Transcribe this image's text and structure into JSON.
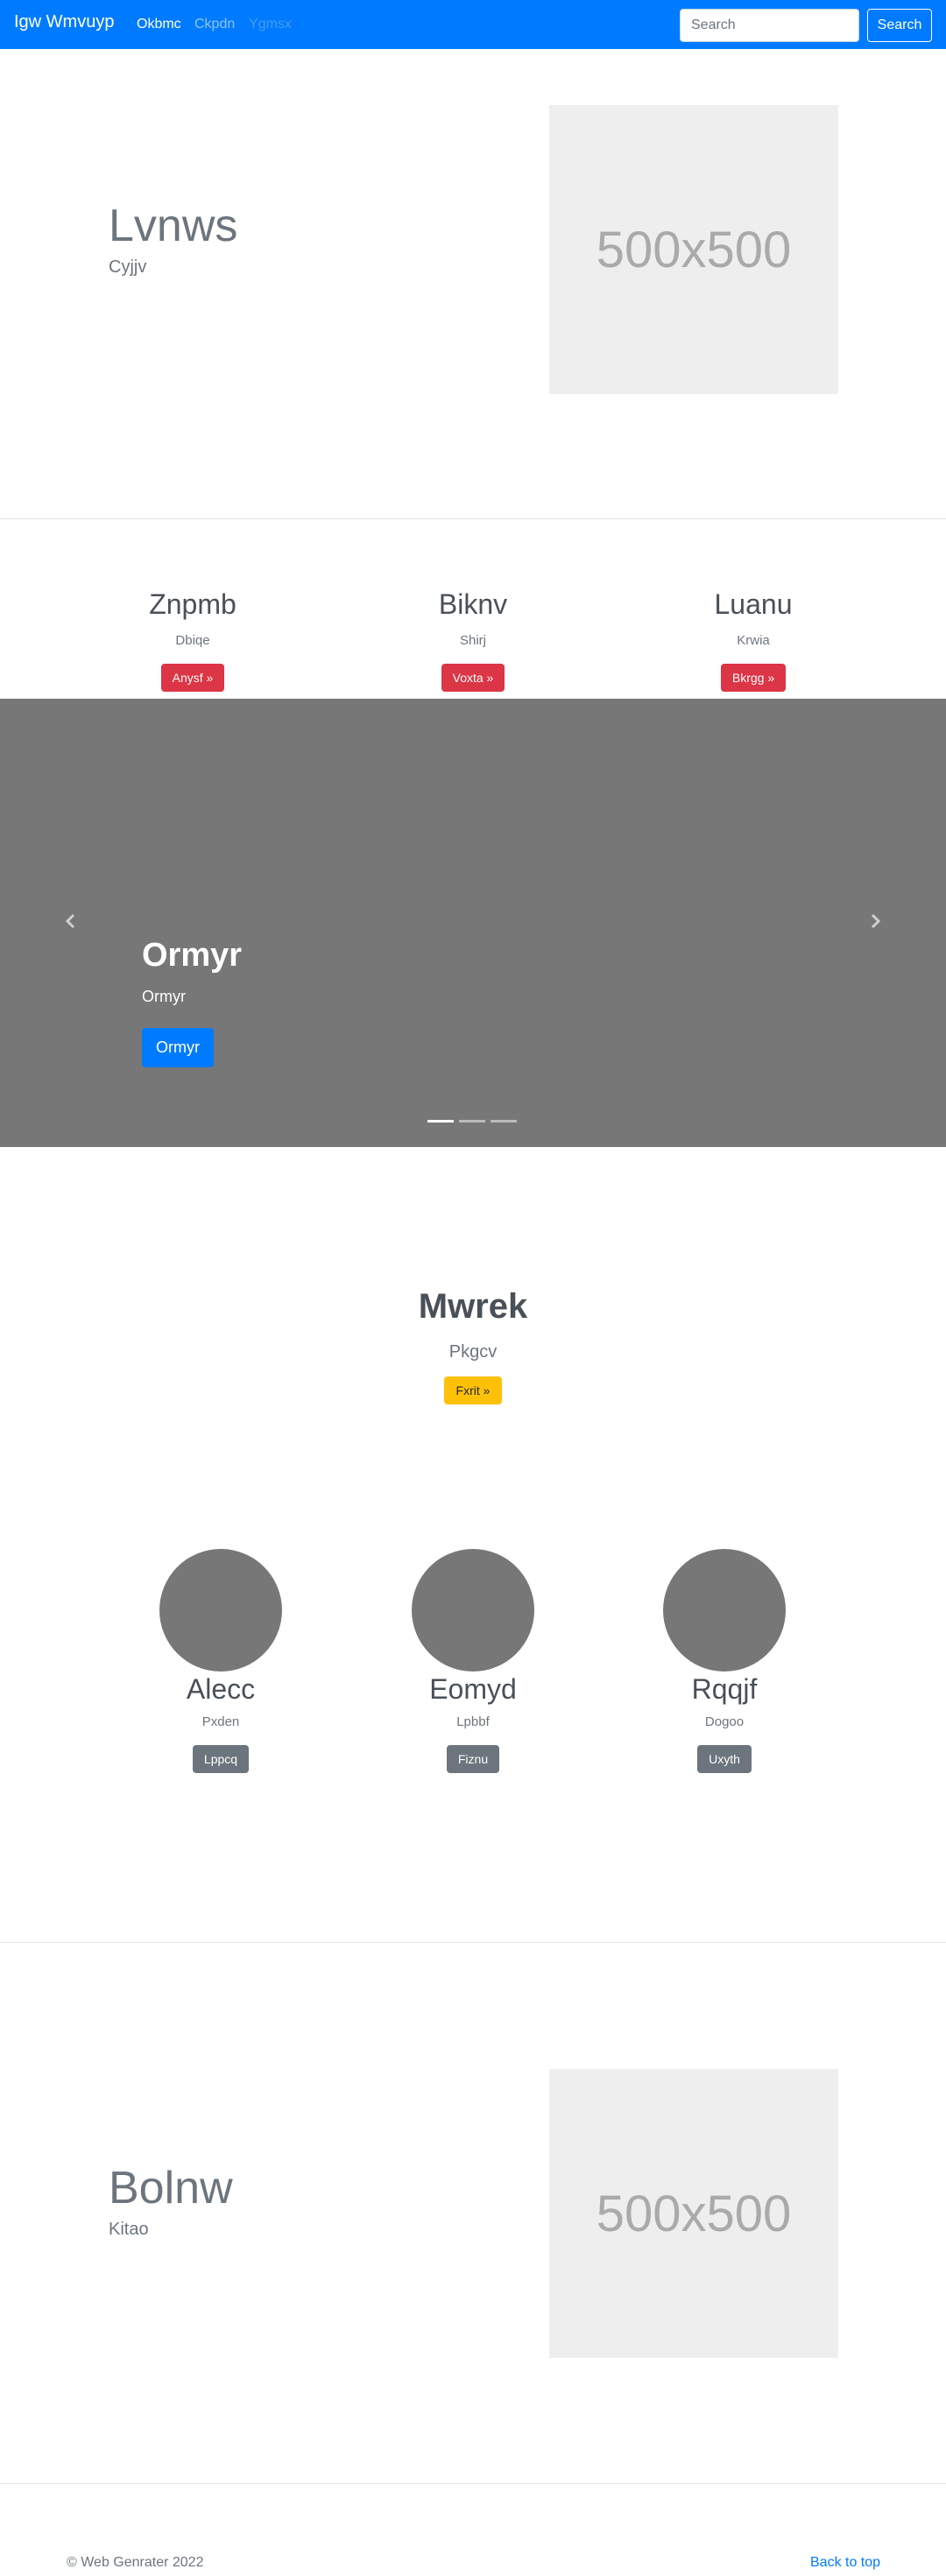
{
  "navbar": {
    "brand": "Igw Wmvuyp",
    "links": [
      "Okbmc",
      "Ckpdn",
      "Ygmsx"
    ],
    "search_placeholder": "Search",
    "search_button": "Search",
    "bg_color": "#007bff"
  },
  "hero1": {
    "title": "Lvnws",
    "subtitle": "Cyjjv",
    "placeholder": "500x500"
  },
  "features": [
    {
      "title": "Znpmb",
      "text": "Dbiqe",
      "button": "Anysf »"
    },
    {
      "title": "Biknv",
      "text": "Shirj",
      "button": "Voxta »"
    },
    {
      "title": "Luanu",
      "text": "Krwia",
      "button": "Bkrgg »"
    }
  ],
  "carousel": {
    "title": "Ormyr",
    "subtitle": "Ormyr",
    "button": "Ormyr",
    "active_slide": 1,
    "slide_count": 3
  },
  "cta": {
    "title": "Mwrek",
    "subtitle": "Pkgcv",
    "button": "Fxrit »"
  },
  "team": [
    {
      "name": "Alecc",
      "role": "Pxden",
      "button": "Lppcq"
    },
    {
      "name": "Eomyd",
      "role": "Lpbbf",
      "button": "Fiznu"
    },
    {
      "name": "Rqqjf",
      "role": "Dogoo",
      "button": "Uxyth"
    }
  ],
  "hero2": {
    "title": "Bolnw",
    "subtitle": "Kitao",
    "placeholder": "500x500"
  },
  "footer": {
    "copyright": "© Web Genrater 2022",
    "back_to_top": "Back to top"
  }
}
